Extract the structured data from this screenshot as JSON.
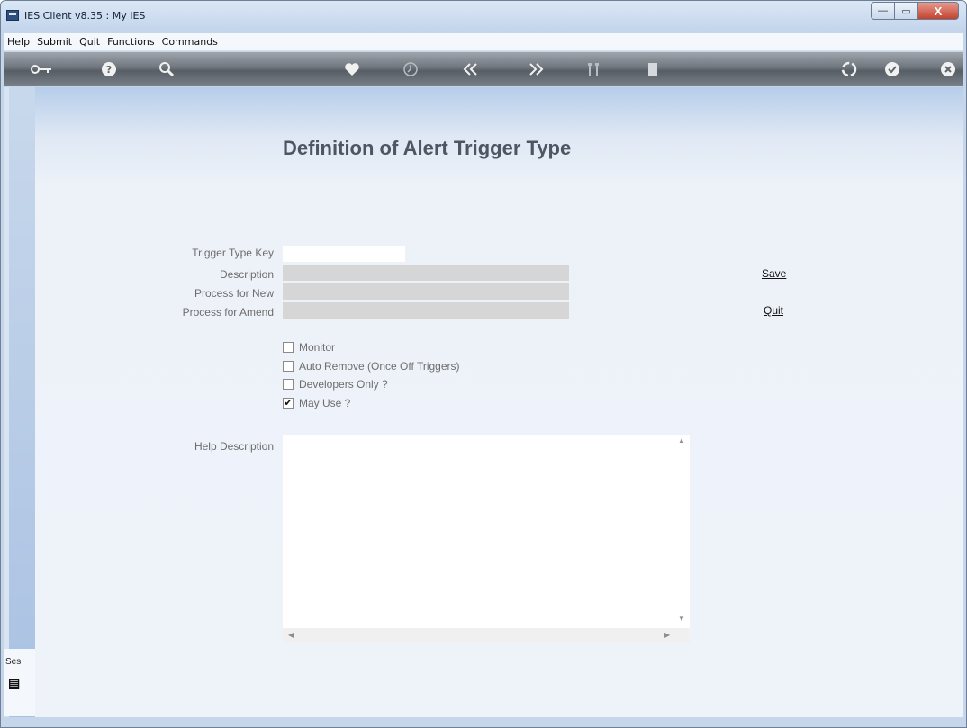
{
  "window": {
    "title": "IES Client v8.35 : My IES",
    "controls": {
      "minimize": "—",
      "maximize": "▭",
      "close": "X"
    }
  },
  "menu": [
    "Help",
    "Submit",
    "Quit",
    "Functions",
    "Commands"
  ],
  "toolbar_icons": [
    "key-icon",
    "help-icon",
    "search-icon",
    "heart-icon",
    "clock-icon",
    "rewind-icon",
    "forward-icon",
    "tools-icon",
    "page-icon",
    "recycle-icon",
    "check-icon",
    "close-icon"
  ],
  "form": {
    "title": "Definition of Alert Trigger Type",
    "fields": {
      "trigger_type_key": {
        "label": "Trigger Type Key",
        "value": ""
      },
      "description": {
        "label": "Description",
        "value": ""
      },
      "process_for_new": {
        "label": "Process for New",
        "value": ""
      },
      "process_for_amend": {
        "label": "Process for Amend",
        "value": ""
      }
    },
    "checkboxes": [
      {
        "label": "Monitor",
        "checked": false
      },
      {
        "label": "Auto Remove (Once Off Triggers)",
        "checked": false
      },
      {
        "label": "Developers Only ?",
        "checked": false
      },
      {
        "label": "May Use ?",
        "checked": true
      }
    ],
    "help_description": {
      "label": "Help Description",
      "value": ""
    },
    "actions": {
      "save": "Save",
      "quit": "Quit"
    }
  },
  "sidebar": {
    "session_label": "Ses"
  }
}
